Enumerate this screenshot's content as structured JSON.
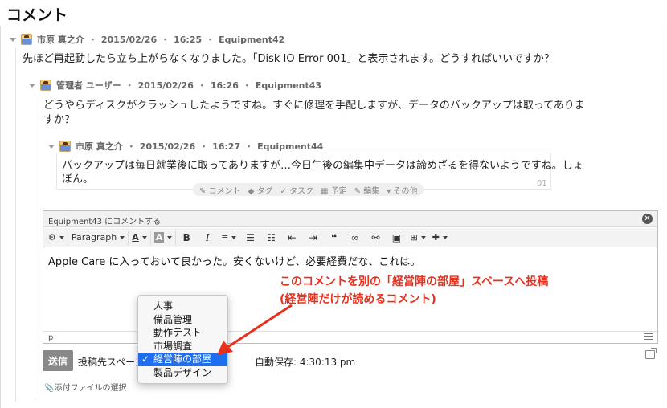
{
  "page": {
    "title": "コメント"
  },
  "comments": [
    {
      "author": "市原 真之介",
      "date": "2015/02/26",
      "time": "16:25",
      "space": "Equipment42",
      "body": "先ほど再起動したら立ち上がらなくなりました。「Disk IO Error 001」と表示されます。どうすればいいですか？"
    },
    {
      "author": "管理者 ユーザー",
      "date": "2015/02/26",
      "time": "16:26",
      "space": "Equipment43",
      "body_line1": "どうやらディスクがクラッシュしたようですね。すぐに修理を手配しますが、データのバックアップは取ってありま",
      "body_line2": "すか？"
    },
    {
      "author": "市原 真之介",
      "date": "2015/02/26",
      "time": "16:27",
      "space": "Equipment44",
      "body_line1": "バックアップは毎日就業後に取ってありますが…今日午後の編集中データは諦めざるを得ないようですね。しょ",
      "body_line2": "ぼん。",
      "number": "01"
    }
  ],
  "separator": "・",
  "actions": {
    "comment": "コメント",
    "tag": "タグ",
    "task": "タスク",
    "schedule": "予定",
    "edit": "編集",
    "more": "その他"
  },
  "editor": {
    "header": "Equipment43 にコメントする",
    "paragraph_label": "Paragraph",
    "content": "Apple Care に入っておいて良かった。安くないけど、必要経費だな、これは。",
    "status_path": "p"
  },
  "footer": {
    "send_label": "送信",
    "target_label": "投稿先スペース：",
    "autosave": "自動保存: 4:30:13 pm",
    "attach_label": "添付ファイルの選択"
  },
  "dropdown": {
    "options": [
      "人事",
      "備品管理",
      "動作テスト",
      "市場調査",
      "経営陣の部屋",
      "製品デザイン"
    ],
    "selected_index": 4
  },
  "annotation": {
    "line1": "このコメントを別の「経営陣の部屋」スペースへ投稿",
    "line2": "(経営陣だけが読めるコメント)"
  },
  "colors": {
    "annotation": "#e8301c",
    "selection": "#1c6ff0"
  }
}
